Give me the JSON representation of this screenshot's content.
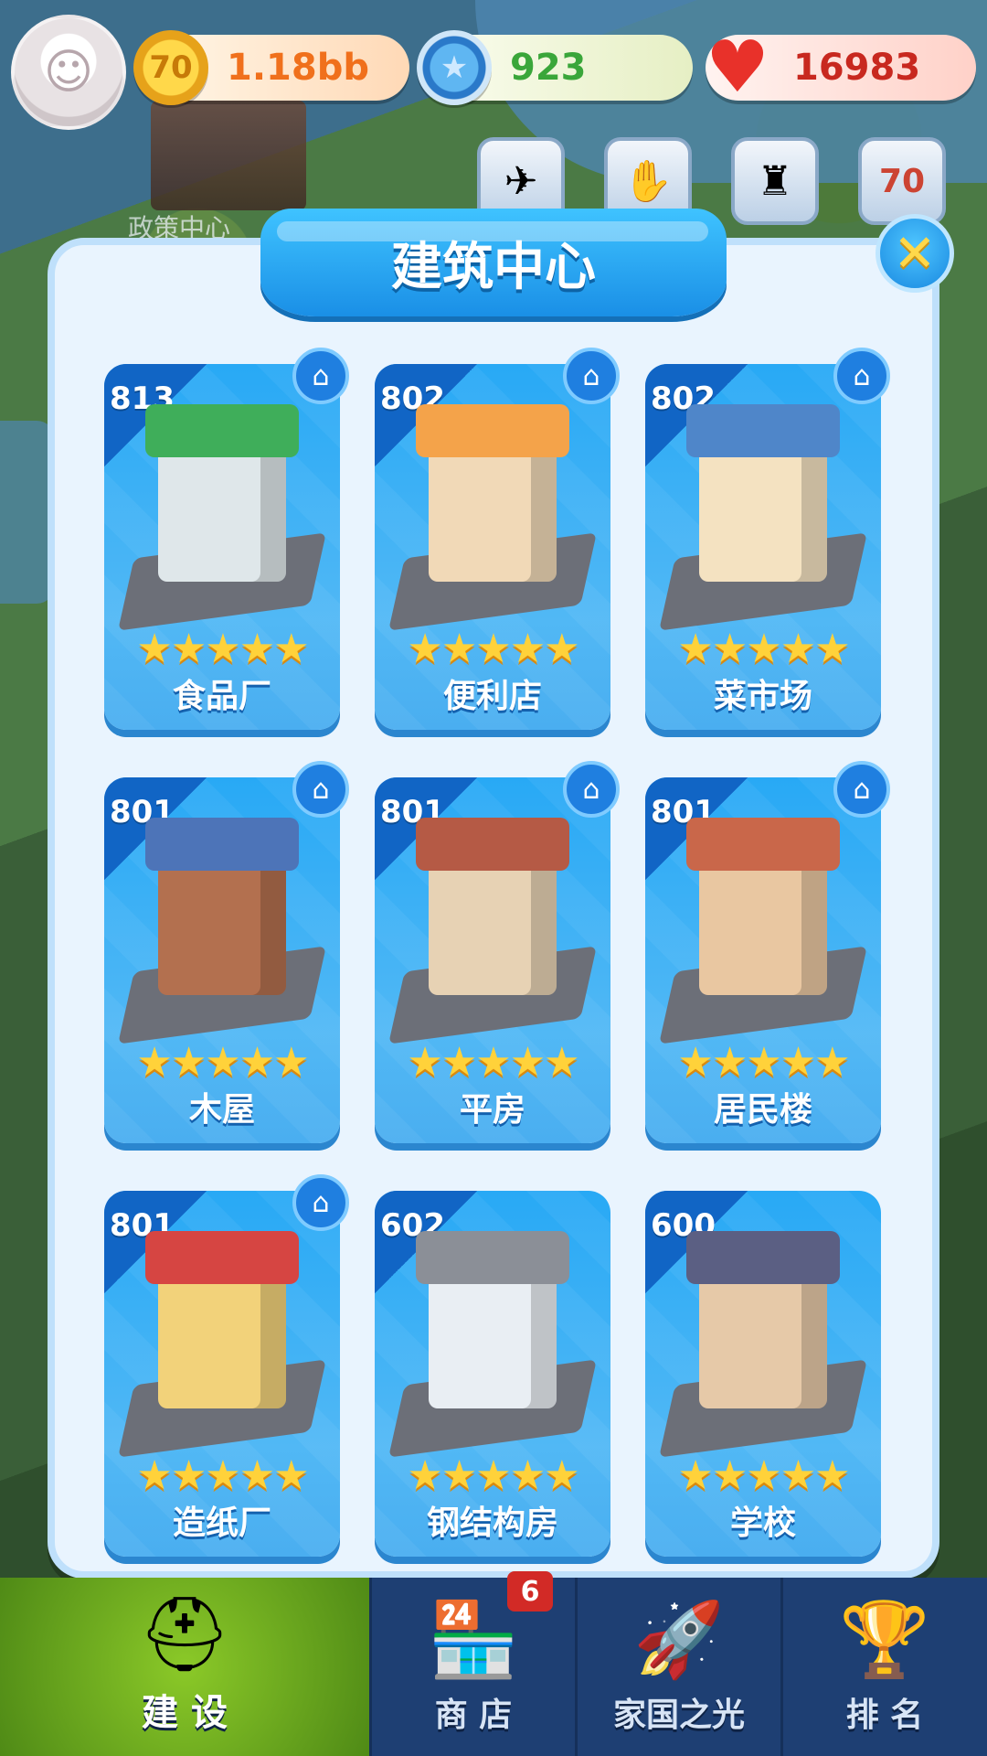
{
  "header": {
    "avatar_icon": "avatar-girl-icon",
    "resources": [
      {
        "name": "coin",
        "icon": "coin-70-icon",
        "value": "1.18bb",
        "color": "#f0701c"
      },
      {
        "name": "gem",
        "icon": "blue-star-gem-icon",
        "value": "923",
        "color": "#3aa63a"
      },
      {
        "name": "heart",
        "icon": "heart-icon",
        "value": "16983",
        "color": "#c8281f"
      }
    ],
    "quick_buttons": [
      "plane-icon",
      "handshake-icon",
      "statue-icon",
      "anniversary-70-icon"
    ]
  },
  "background": {
    "policy_center_label": "政策中心"
  },
  "panel": {
    "title": "建筑中心",
    "close_icon": "close-x-icon",
    "cards": [
      {
        "level": "813",
        "name": "食品厂",
        "stars": "★★★★★",
        "has_home": true,
        "colors": [
          "#3fae5a",
          "#dfe7ea"
        ]
      },
      {
        "level": "802",
        "name": "便利店",
        "stars": "★★★★★",
        "has_home": true,
        "colors": [
          "#f4a34a",
          "#f1d9b7"
        ]
      },
      {
        "level": "802",
        "name": "菜市场",
        "stars": "★★★★★",
        "has_home": true,
        "colors": [
          "#4f86c9",
          "#f4e2c1"
        ]
      },
      {
        "level": "801",
        "name": "木屋",
        "stars": "★★★★★",
        "has_home": true,
        "colors": [
          "#4d74b8",
          "#b3704f"
        ]
      },
      {
        "level": "801",
        "name": "平房",
        "stars": "★★★★★",
        "has_home": true,
        "colors": [
          "#b55a45",
          "#e7d2b4"
        ]
      },
      {
        "level": "801",
        "name": "居民楼",
        "stars": "★★★★★",
        "has_home": true,
        "colors": [
          "#c9674a",
          "#e9c7a1"
        ]
      },
      {
        "level": "801",
        "name": "造纸厂",
        "stars": "★★★★★",
        "has_home": true,
        "colors": [
          "#d64542",
          "#f2d27a"
        ]
      },
      {
        "level": "602",
        "name": "钢结构房",
        "stars": "★★★★★",
        "has_home": false,
        "colors": [
          "#8b8f97",
          "#e9eef3"
        ]
      },
      {
        "level": "600",
        "name": "学校",
        "stars": "★★★★★",
        "has_home": false,
        "colors": [
          "#5b5f83",
          "#e6c9a8"
        ]
      }
    ]
  },
  "nav": {
    "badge": "6",
    "items": [
      {
        "label": "建 设",
        "icon": "hardhat-icon"
      },
      {
        "label": "商 店",
        "icon": "shop-icon"
      },
      {
        "label": "家国之光",
        "icon": "rocket-icon"
      },
      {
        "label": "排 名",
        "icon": "ranking-icon"
      }
    ]
  }
}
